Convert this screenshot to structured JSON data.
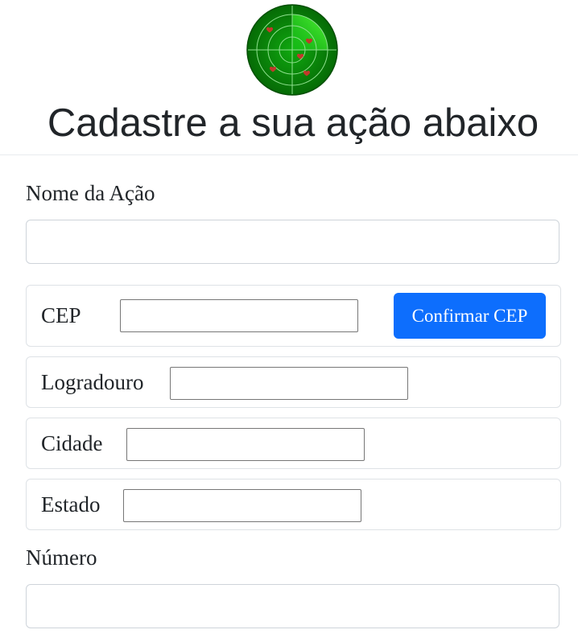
{
  "header": {
    "title": "Cadastre a sua ação abaixo",
    "logo_icon": "radar-icon"
  },
  "form": {
    "nome_label": "Nome da Ação",
    "nome_value": "",
    "cep_label": "CEP",
    "cep_value": "",
    "confirm_cep_label": "Confirmar CEP",
    "logradouro_label": "Logradouro",
    "logradouro_value": "",
    "cidade_label": "Cidade",
    "cidade_value": "",
    "estado_label": "Estado",
    "estado_value": "",
    "numero_label": "Número",
    "numero_value": ""
  },
  "colors": {
    "primary": "#0d6efd",
    "radar_green": "#0a8a0a",
    "heart_red": "#c0392b"
  }
}
